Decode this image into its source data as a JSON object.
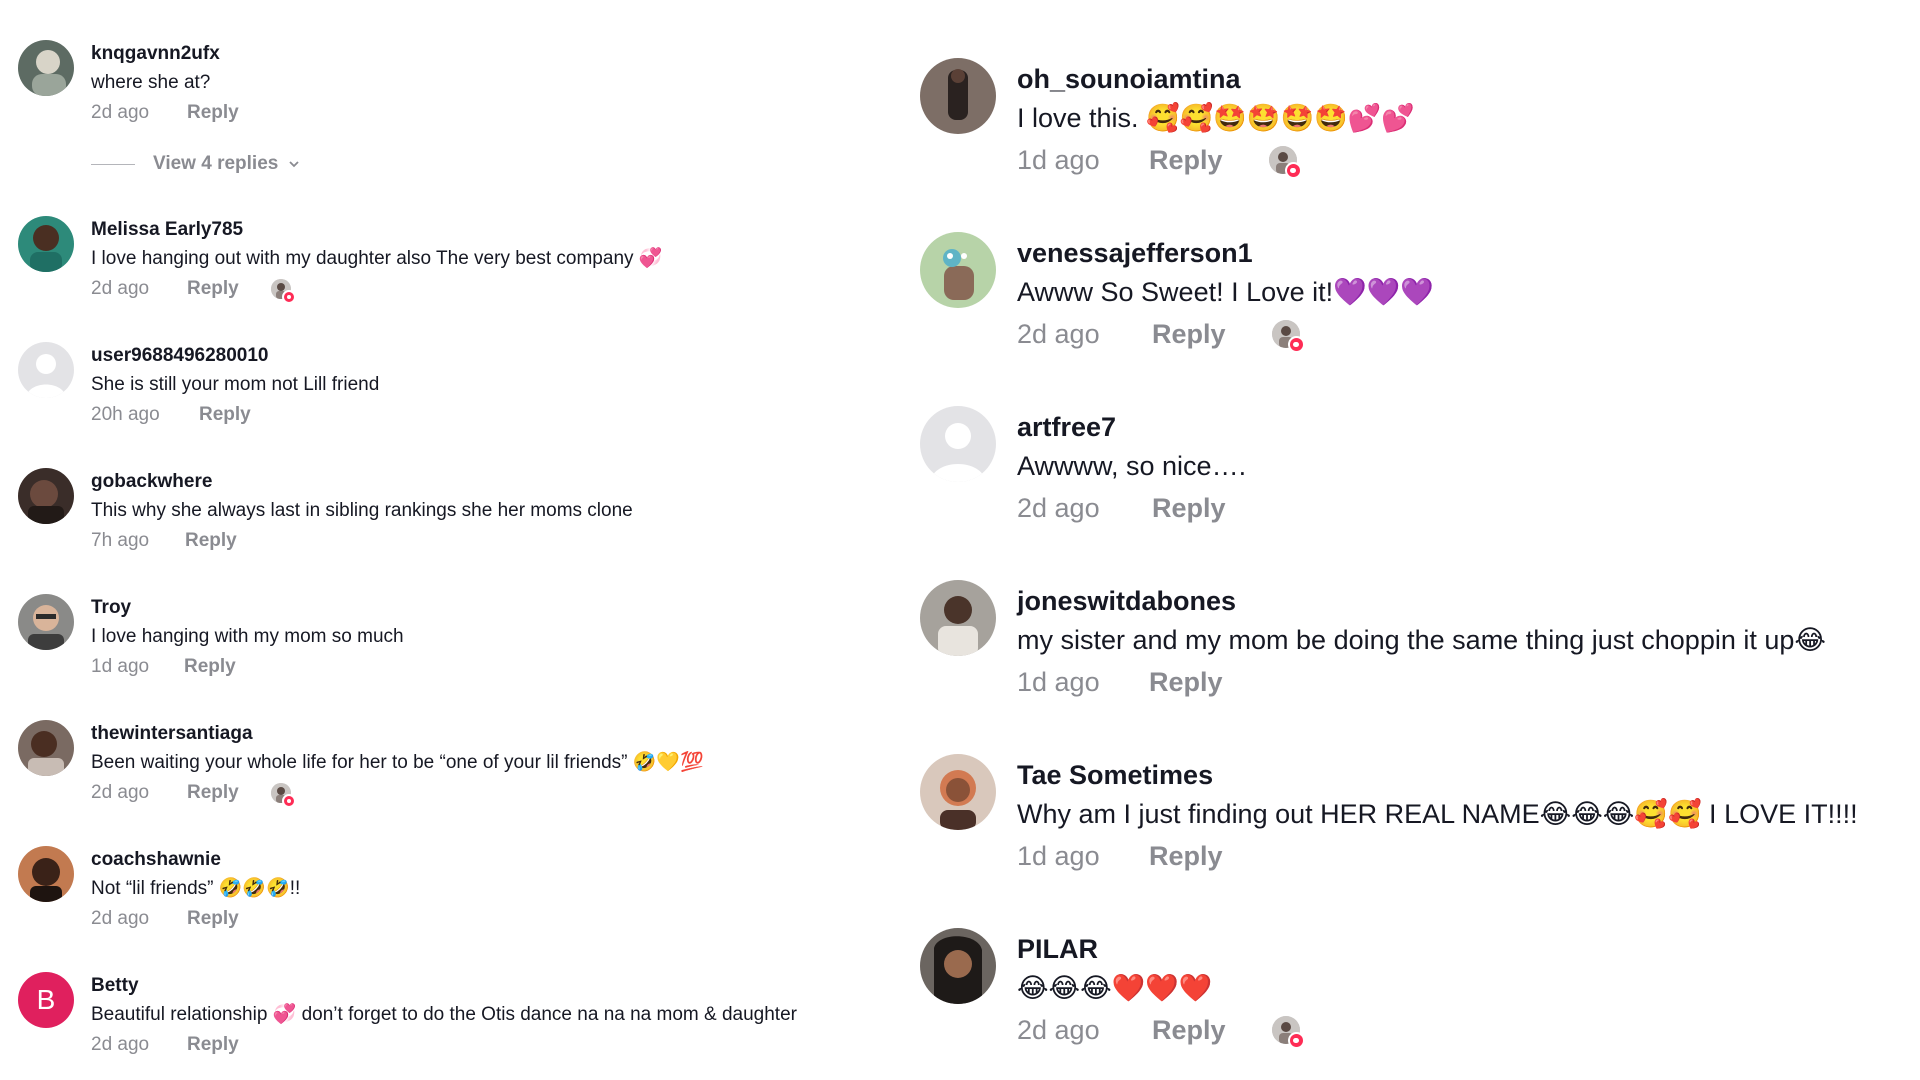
{
  "left_comments": [
    {
      "username": "knqgavnn2ufx",
      "text": "where she at?",
      "time": "2d ago",
      "reply": "Reply",
      "liked_by_creator": false
    },
    {
      "username": "Melissa Early785",
      "text": "I love hanging out with my daughter also The very best company 💞",
      "time": "2d ago",
      "reply": "Reply",
      "liked_by_creator": true
    },
    {
      "username": "user9688496280010",
      "text": "She is still your mom not Lill friend",
      "time": "20h ago",
      "reply": "Reply",
      "liked_by_creator": false
    },
    {
      "username": "gobackwhere",
      "text": "This why she always last in sibling rankings she her moms clone",
      "time": "7h ago",
      "reply": "Reply",
      "liked_by_creator": false
    },
    {
      "username": "Troy",
      "text": "I love hanging with my mom so much",
      "time": "1d ago",
      "reply": "Reply",
      "liked_by_creator": false
    },
    {
      "username": "thewintersantiaga",
      "text": "Been waiting your whole life for her to be “one of your lil friends” 🤣💛💯",
      "time": "2d ago",
      "reply": "Reply",
      "liked_by_creator": true
    },
    {
      "username": "coachshawnie",
      "text": "Not “lil friends” 🤣🤣🤣!!",
      "time": "2d ago",
      "reply": "Reply",
      "liked_by_creator": false
    },
    {
      "username": "Betty",
      "avatar_letter": "B",
      "text": "Beautiful relationship 💞 don’t forget to do the Otis dance na na na mom & daughter",
      "time": "2d ago",
      "reply": "Reply",
      "liked_by_creator": false
    }
  ],
  "view_replies_label": "View 4 replies",
  "right_comments": [
    {
      "username": "oh_sounoiamtina",
      "text": "I love this. 🥰🥰🤩🤩🤩🤩💕💕",
      "time": "1d ago",
      "reply": "Reply",
      "liked_by_creator": true
    },
    {
      "username": "venessajefferson1",
      "text": "Awww So Sweet! I Love it!💜💜💜",
      "time": "2d ago",
      "reply": "Reply",
      "liked_by_creator": true
    },
    {
      "username": "artfree7",
      "text": "Awwww, so nice….",
      "time": "2d ago",
      "reply": "Reply",
      "liked_by_creator": false
    },
    {
      "username": "joneswitdabones",
      "text": "my sister and my mom be doing the same thing just choppin it up😂",
      "time": "1d ago",
      "reply": "Reply",
      "liked_by_creator": false
    },
    {
      "username": "Tae Sometimes",
      "text": "Why am I just finding out HER REAL NAME😂😂😂🥰🥰 I LOVE IT!!!!",
      "time": "1d ago",
      "reply": "Reply",
      "liked_by_creator": false
    },
    {
      "username": "PILAR",
      "text": "😂😂😂❤️❤️❤️",
      "time": "2d ago",
      "reply": "Reply",
      "liked_by_creator": true
    }
  ],
  "colors": {
    "username": "#161823",
    "meta": "#8a8b91",
    "heart_badge": "#fe2c55",
    "letter_avatar_bg": "#e0205e",
    "default_avatar_bg": "#e3e3e6"
  },
  "icons": [
    "default-profile-icon",
    "liked-by-creator-icon",
    "chevron-down-icon"
  ]
}
